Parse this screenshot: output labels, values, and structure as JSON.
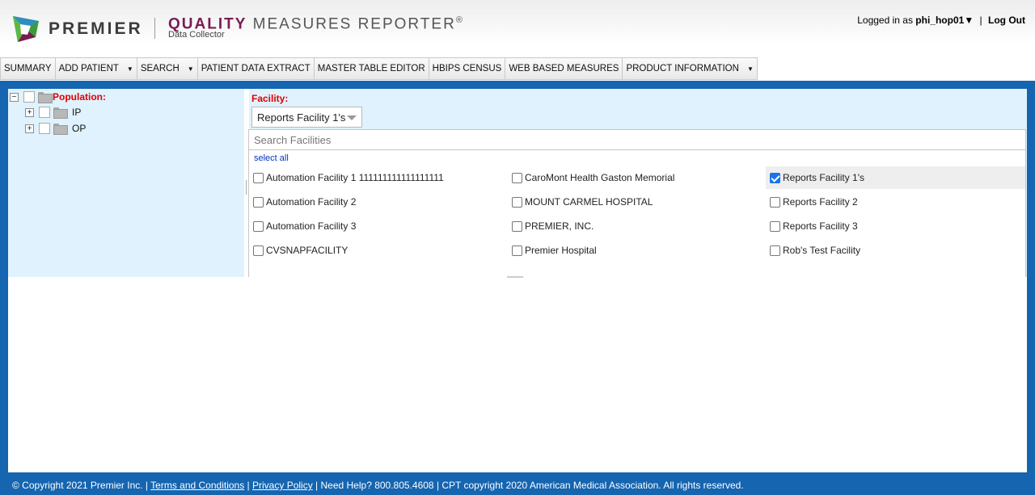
{
  "header": {
    "brand": "PREMIER",
    "product_quality": "QUALITY",
    "product_rest": " MEASURES REPORTER",
    "registered": "®",
    "subtitle": "Data Collector",
    "logged_in_prefix": "Logged in as ",
    "username": "phi_hop01",
    "user_caret": "▼",
    "separator": "|",
    "logout": "Log Out"
  },
  "nav": [
    {
      "label": "SUMMARY",
      "caret": ""
    },
    {
      "label": "ADD PATIENT",
      "caret": "▼"
    },
    {
      "label": "SEARCH",
      "caret": "▼"
    },
    {
      "label": "PATIENT DATA EXTRACT",
      "caret": ""
    },
    {
      "label": "MASTER TABLE EDITOR",
      "caret": ""
    },
    {
      "label": "HBIPS CENSUS",
      "caret": ""
    },
    {
      "label": "WEB BASED MEASURES",
      "caret": ""
    },
    {
      "label": "PRODUCT INFORMATION",
      "caret": "▼"
    }
  ],
  "tree": {
    "root_expander": "−",
    "root_label": "Population:",
    "children": [
      {
        "expander": "+",
        "label": "IP"
      },
      {
        "expander": "+",
        "label": "OP"
      }
    ]
  },
  "facility": {
    "label": "Facility:",
    "selected": "Reports Facility 1's",
    "search_placeholder": "Search Facilities",
    "select_all": "select all",
    "columns": [
      [
        {
          "label": "Automation Facility 1 111111111111111111",
          "checked": false
        },
        {
          "label": "Automation Facility 2",
          "checked": false
        },
        {
          "label": "Automation Facility 3",
          "checked": false
        },
        {
          "label": "CVSNAPFACILITY",
          "checked": false
        }
      ],
      [
        {
          "label": "CaroMont Health Gaston Memorial",
          "checked": false
        },
        {
          "label": "MOUNT CARMEL HOSPITAL",
          "checked": false
        },
        {
          "label": "PREMIER, INC.",
          "checked": false
        },
        {
          "label": "Premier Hospital",
          "checked": false
        }
      ],
      [
        {
          "label": "Reports Facility 1's",
          "checked": true
        },
        {
          "label": "Reports Facility 2",
          "checked": false
        },
        {
          "label": "Reports Facility 3",
          "checked": false
        },
        {
          "label": "Rob's Test Facility",
          "checked": false
        }
      ]
    ]
  },
  "footer": {
    "copyright": "© Copyright 2021 Premier Inc.  | ",
    "terms": "Terms and Conditions",
    "sep1": " | ",
    "privacy": "Privacy Policy",
    "rest": " | Need Help? 800.805.4608 | CPT copyright 2020 American Medical Association. All rights reserved."
  },
  "colors": {
    "brand_purple": "#7a1b52",
    "background_blue": "#1565b0",
    "panel_blue": "#e0f2fd",
    "required_red": "#e00000"
  }
}
